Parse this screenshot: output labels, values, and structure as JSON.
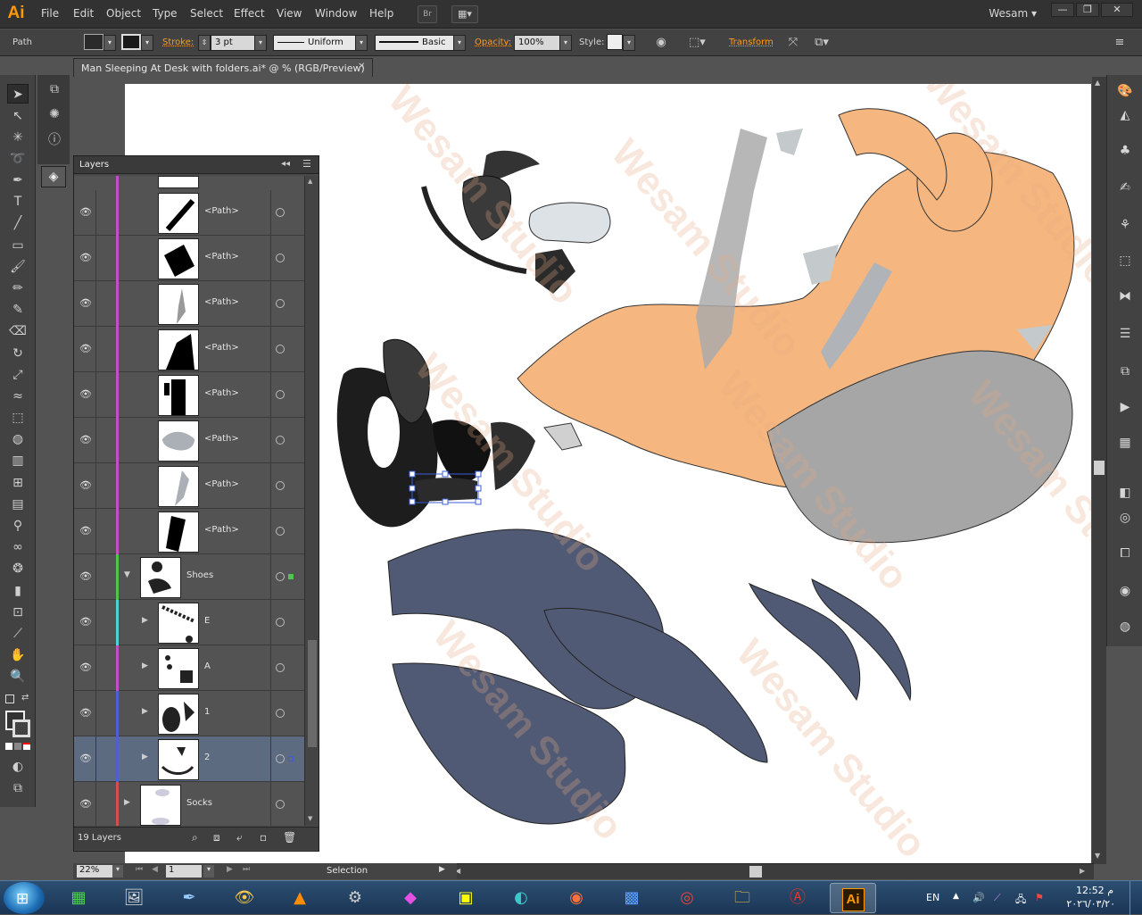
{
  "app": {
    "logo": "Ai",
    "menu": [
      "File",
      "Edit",
      "Object",
      "Type",
      "Select",
      "Effect",
      "View",
      "Window",
      "Help"
    ],
    "bridge_label": "Br",
    "user_name": "Wesam",
    "win_buttons": [
      "—",
      "❐",
      "✕"
    ]
  },
  "control_bar": {
    "object_type": "Path",
    "stroke_label": "Stroke:",
    "stroke_value": "3 pt",
    "profile_value": "Uniform",
    "brush_value": "Basic",
    "opacity_label": "Opacity:",
    "opacity_value": "100%",
    "style_label": "Style:",
    "transform_label": "Transform"
  },
  "document": {
    "tab_title": "Man Sleeping At Desk with folders.ai* @ % (RGB/Preview)",
    "watermark": "Wesam Studio"
  },
  "layers_panel": {
    "title": "Layers",
    "footer_count": "19 Layers",
    "rows": [
      {
        "name": "<Path>",
        "color": "#c44fc4",
        "expandable": false,
        "selected": false
      },
      {
        "name": "<Path>",
        "color": "#c44fc4",
        "expandable": false,
        "selected": false
      },
      {
        "name": "<Path>",
        "color": "#c44fc4",
        "expandable": false,
        "selected": false
      },
      {
        "name": "<Path>",
        "color": "#c44fc4",
        "expandable": false,
        "selected": false
      },
      {
        "name": "<Path>",
        "color": "#c44fc4",
        "expandable": false,
        "selected": false
      },
      {
        "name": "<Path>",
        "color": "#c44fc4",
        "expandable": false,
        "selected": false
      },
      {
        "name": "<Path>",
        "color": "#c44fc4",
        "expandable": false,
        "selected": false
      },
      {
        "name": "<Path>",
        "color": "#c44fc4",
        "expandable": false,
        "selected": false
      },
      {
        "name": "Shoes",
        "color": "#4fc44f",
        "expandable": true,
        "selected": false
      },
      {
        "name": "E",
        "color": "#4fd1d1",
        "expandable": true,
        "selected": false
      },
      {
        "name": "A",
        "color": "#c44fc4",
        "expandable": true,
        "selected": false
      },
      {
        "name": "1",
        "color": "#4f5fd1",
        "expandable": true,
        "selected": false
      },
      {
        "name": "2",
        "color": "#4f5fd1",
        "expandable": true,
        "selected": true
      },
      {
        "name": "Socks",
        "color": "#d14f4f",
        "expandable": true,
        "selected": false
      }
    ]
  },
  "status_bar": {
    "zoom": "22%",
    "artboard_index": "1",
    "tool_status": "Selection"
  },
  "taskbar": {
    "language": "EN",
    "time": "12:52 م",
    "date": "٢٠٢٦/٠٣/٢٠",
    "apps": [
      "Task Manager",
      "Paint",
      "Brush",
      "Eye",
      "VLC",
      "Tools",
      "Color",
      "Studio",
      "Edge",
      "Firefox",
      "Maxthon",
      "Chrome",
      "Explorer",
      "Autodesk",
      "Illustrator"
    ]
  }
}
